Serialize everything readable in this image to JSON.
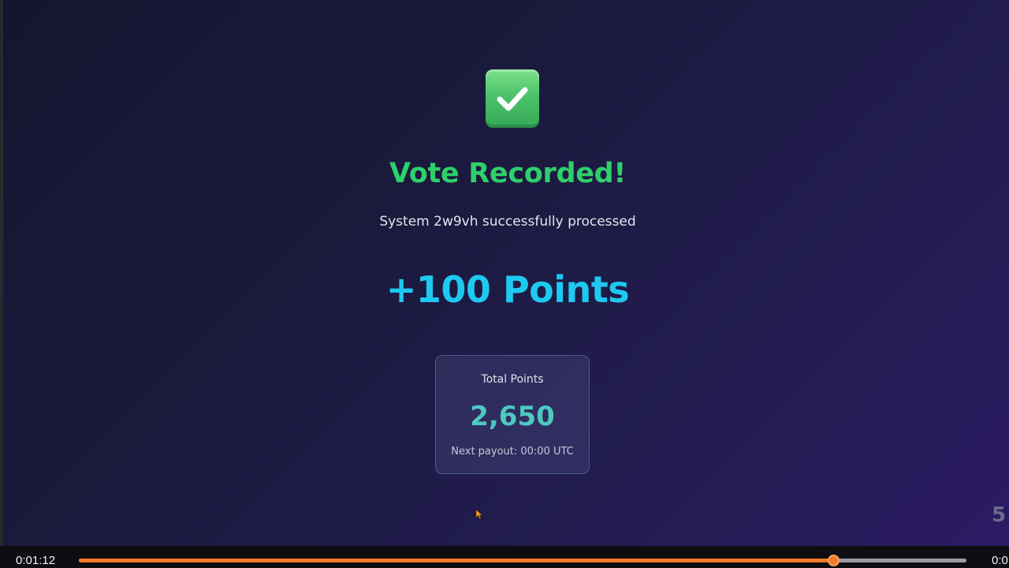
{
  "success": {
    "icon": "check-mark-button-icon",
    "title": "Vote Recorded!",
    "subtitle": "System 2w9vh successfully processed",
    "points_awarded": "+100 Points"
  },
  "summary_card": {
    "label": "Total Points",
    "value": "2,650",
    "footer": "Next payout: 00:00 UTC"
  },
  "slide_number": "5",
  "player": {
    "current_time": "0:01:12",
    "total_time": "0:0",
    "progress": 0.85
  },
  "colors": {
    "title": "#2fcf6a",
    "points": "#1ec9f0",
    "total_value": "#4dc9c0",
    "progress": "#f07a2a"
  }
}
